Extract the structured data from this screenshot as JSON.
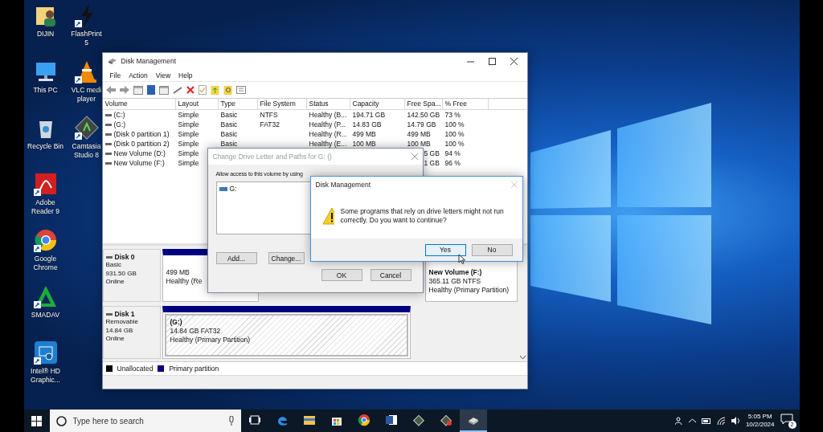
{
  "desktop_icons": {
    "column_1": [
      {
        "label": "DIJIN",
        "kind": "user-folder",
        "shortcut": false
      },
      {
        "label": "This PC",
        "kind": "computer",
        "shortcut": false
      },
      {
        "label": "Recycle Bin",
        "kind": "recycle-bin",
        "shortcut": false
      },
      {
        "label": "Adobe Reader 9",
        "kind": "pdf",
        "shortcut": true
      },
      {
        "label": "Google Chrome",
        "kind": "chrome",
        "shortcut": true
      },
      {
        "label": "SMADAV",
        "kind": "smadav",
        "shortcut": true
      },
      {
        "label": "Intel® HD Graphic...",
        "kind": "intel",
        "shortcut": true
      }
    ],
    "column_2": [
      {
        "label": "FlashPrint 5",
        "kind": "flashprint",
        "shortcut": true
      },
      {
        "label": "VLC medi player",
        "kind": "vlc",
        "shortcut": true
      },
      {
        "label": "Camtasia Studio 8",
        "kind": "camtasia",
        "shortcut": true
      }
    ]
  },
  "main_window": {
    "title": "Disk Management",
    "menu": [
      "File",
      "Action",
      "View",
      "Help"
    ],
    "table": {
      "columns": [
        "Volume",
        "Layout",
        "Type",
        "File System",
        "Status",
        "Capacity",
        "Free Spa...",
        "% Free"
      ],
      "rows": [
        [
          "(C:)",
          "Simple",
          "Basic",
          "NTFS",
          "Healthy (B...",
          "194.71 GB",
          "142.50 GB",
          "73 %"
        ],
        [
          "(G:)",
          "Simple",
          "Basic",
          "FAT32",
          "Healthy (P...",
          "14.83 GB",
          "14.79 GB",
          "100 %"
        ],
        [
          "(Disk 0 partition 1)",
          "Simple",
          "Basic",
          null,
          "Healthy (R...",
          "499 MB",
          "499 MB",
          "100 %"
        ],
        [
          "(Disk 0 partition 2)",
          "Simple",
          "Basic",
          null,
          "Healthy (E...",
          "100 MB",
          "100 MB",
          "100 %"
        ],
        [
          "New Volume (D:)",
          "Simple",
          null,
          null,
          null,
          null,
          "5 GB",
          "94 %"
        ],
        [
          "New Volume (F:)",
          "Simple",
          null,
          null,
          null,
          null,
          "1 GB",
          "96 %"
        ]
      ]
    },
    "disks": [
      {
        "name": "Disk 0",
        "type": "Basic",
        "size": "931.50 GB",
        "status": "Online",
        "partitions": [
          {
            "lines": [
              "499 MB",
              "Healthy (Re"
            ],
            "selected": false
          },
          {
            "title": "New Volume  (F:)",
            "lines": [
              "365.11 GB NTFS",
              "Healthy (Primary Partition)"
            ],
            "selected": false
          }
        ]
      },
      {
        "name": "Disk 1",
        "type": "Removable",
        "size": "14.84 GB",
        "status": "Online",
        "partitions": [
          {
            "title": "(G:)",
            "lines": [
              "14.84 GB FAT32",
              "Healthy (Primary Partition)"
            ],
            "selected": true
          }
        ]
      }
    ],
    "legend": [
      {
        "label": "Unallocated",
        "color": "#000000"
      },
      {
        "label": "Primary partition",
        "color": "#00007f"
      }
    ]
  },
  "change_dialog": {
    "title": "Change Drive Letter and Paths for G: ()",
    "instruction": "Allow access to this volume by using",
    "list": [
      "G:"
    ],
    "buttons": [
      "Add...",
      "Change..."
    ],
    "footer_buttons": [
      "OK",
      "Cancel"
    ]
  },
  "message_box": {
    "title": "Disk Management",
    "message": "Some programs that rely on drive letters might not run correctly. Do you want to continue?",
    "buttons": [
      {
        "label": "Yes",
        "focused": true
      },
      {
        "label": "No",
        "focused": false
      }
    ]
  },
  "taskbar": {
    "search": {
      "placeholder": "Type here to search"
    },
    "apps": [
      {
        "kind": "task-view",
        "active": false
      },
      {
        "kind": "edge",
        "active": false
      },
      {
        "kind": "explorer",
        "active": false
      },
      {
        "kind": "store",
        "active": false
      },
      {
        "kind": "chrome",
        "active": false
      },
      {
        "kind": "word",
        "active": false
      },
      {
        "kind": "camtasia",
        "active": false
      },
      {
        "kind": "recorder",
        "active": false
      },
      {
        "kind": "disk-management",
        "active": true
      }
    ],
    "time": "5:05 PM",
    "date": "10/2/2024",
    "notifications": "2"
  }
}
